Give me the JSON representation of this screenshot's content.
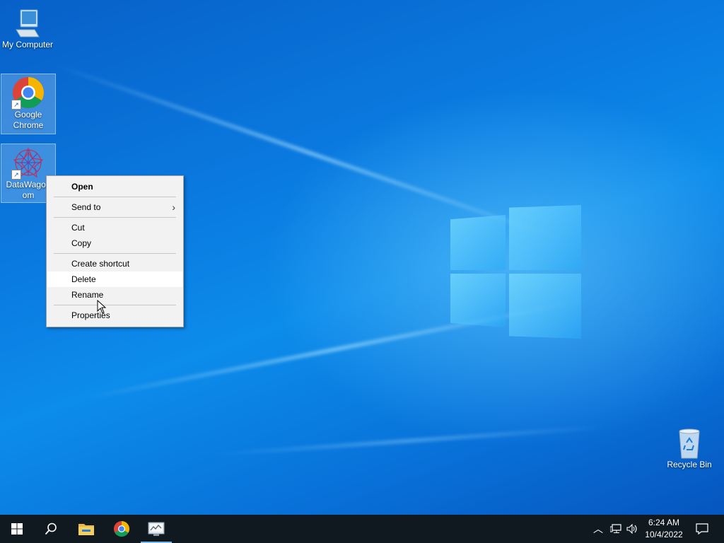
{
  "desktop": {
    "icons": [
      {
        "label_line1": "My Computer",
        "label_line2": ""
      },
      {
        "label_line1": "Google",
        "label_line2": "Chrome"
      },
      {
        "label_line1": "DataWagon",
        "label_line2": "om"
      },
      {
        "label_line1": "Recycle Bin",
        "label_line2": ""
      }
    ]
  },
  "context_menu": {
    "items": [
      "Open",
      "Send to",
      "Cut",
      "Copy",
      "Create shortcut",
      "Delete",
      "Rename",
      "Properties"
    ],
    "highlighted": "Delete"
  },
  "taskbar": {
    "pinned": [
      "start-icon",
      "search-icon",
      "file-explorer-icon",
      "chrome-icon",
      "datawagon-app-icon"
    ],
    "clock": {
      "time": "6:24 AM",
      "date": "10/4/2022"
    }
  },
  "colors": {
    "taskbar": "#101820",
    "menu_bg": "#f2f2f2",
    "selection": "#a0c8f0"
  }
}
